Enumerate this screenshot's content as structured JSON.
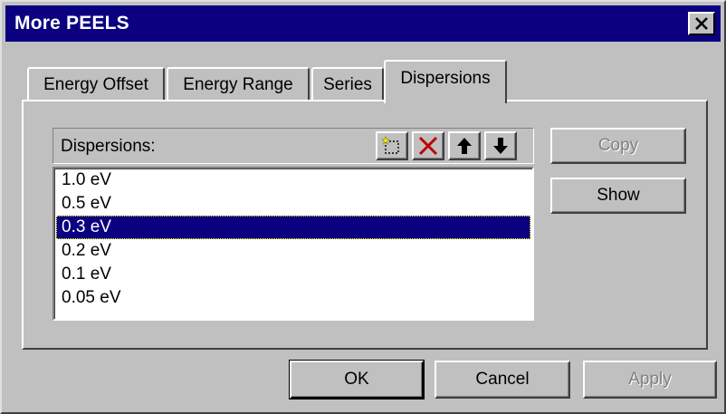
{
  "window": {
    "title": "More PEELS"
  },
  "tabs": [
    {
      "label": "Energy Offset",
      "active": false
    },
    {
      "label": "Energy Range",
      "active": false
    },
    {
      "label": "Series",
      "active": false
    },
    {
      "label": "Dispersions",
      "active": true
    }
  ],
  "dispersions": {
    "header_label": "Dispersions:",
    "toolbar_icons": [
      "new-item-icon",
      "delete-icon",
      "move-up-icon",
      "move-down-icon"
    ],
    "items": [
      "1.0 eV",
      "0.5 eV",
      "0.3 eV",
      "0.2 eV",
      "0.1 eV",
      "0.05 eV"
    ],
    "selected_index": 2
  },
  "side_buttons": {
    "copy_label": "Copy",
    "show_label": "Show"
  },
  "footer": {
    "ok_label": "OK",
    "cancel_label": "Cancel",
    "apply_label": "Apply"
  },
  "colors": {
    "face": "#c0c0c0",
    "title_bar": "#0a0080",
    "selection": "#0a0080",
    "delete_icon": "#c00000"
  }
}
